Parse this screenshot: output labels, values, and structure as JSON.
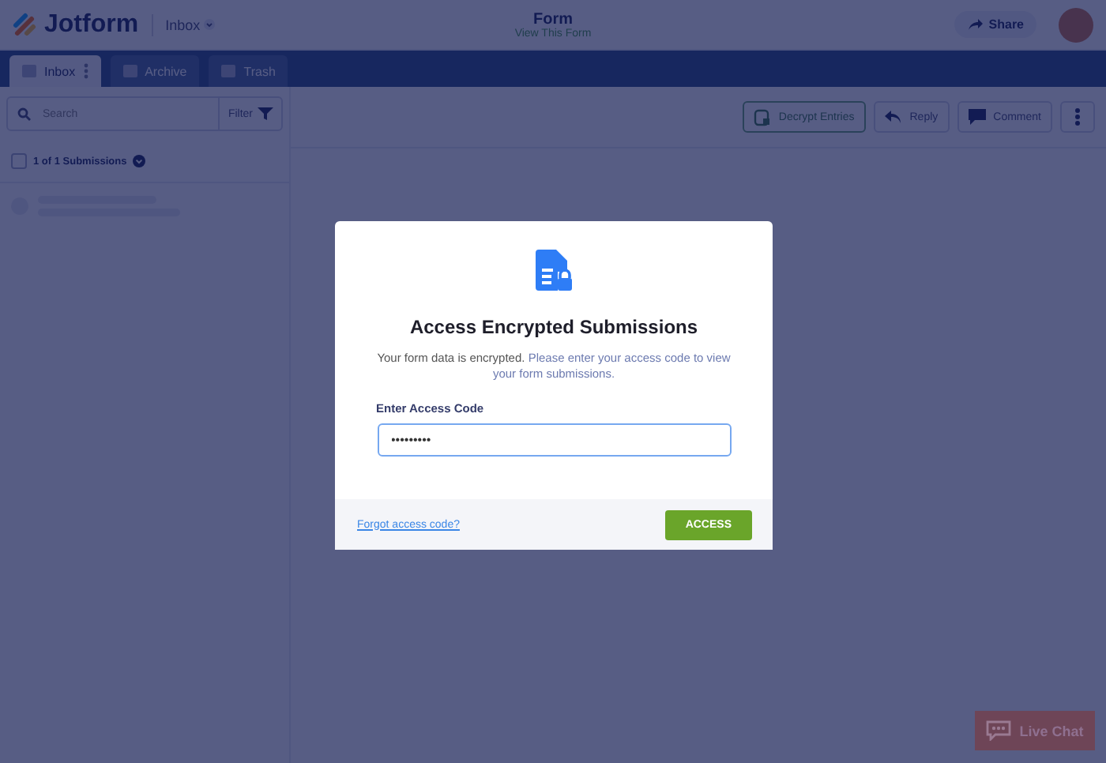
{
  "header": {
    "logo": "Jotform",
    "inbox_menu": "Inbox",
    "form_title": "Form",
    "form_link": "View This Form",
    "share": "Share"
  },
  "tabs": [
    {
      "label": "Inbox",
      "selected": true
    },
    {
      "label": "Archive",
      "selected": false
    },
    {
      "label": "Trash",
      "selected": false
    }
  ],
  "sidebar": {
    "search_placeholder": "Search",
    "filter": "Filter",
    "count": "1 of 1 Submissions",
    "select_all_checked": false
  },
  "toolbar": {
    "buttons": [
      {
        "kind": "decrypt",
        "label": "Decrypt Entries"
      },
      {
        "kind": "reply",
        "label": "Reply"
      },
      {
        "kind": "comment",
        "label": "Comment"
      },
      {
        "kind": "more"
      }
    ]
  },
  "dialog": {
    "title": "Access Encrypted Submissions",
    "message": "Your form data is encrypted.",
    "message_hint": "Please enter your access code to view your form submissions.",
    "field_label": "Enter Access Code",
    "field_value": "•••••••••",
    "forgot_link": "Forgot access code?",
    "submit": "ACCESS"
  },
  "live_chat": "Live Chat"
}
